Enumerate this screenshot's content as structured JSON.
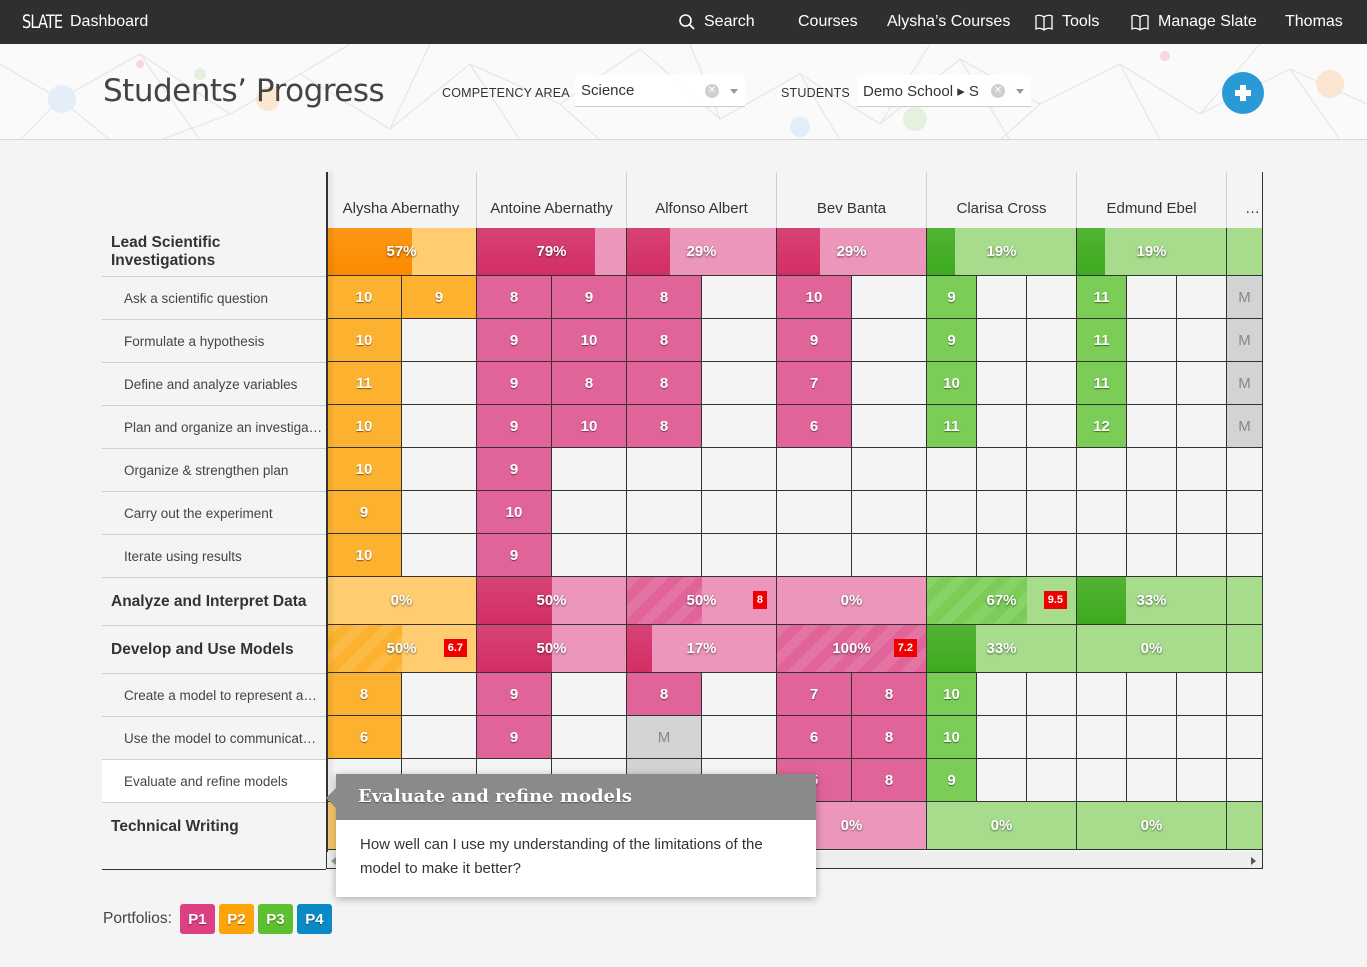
{
  "nav": {
    "logo": "SLATE",
    "brand": "Dashboard",
    "items": [
      {
        "label": "Search",
        "icon": "search-icon"
      },
      {
        "label": "Courses"
      },
      {
        "label": "Alysha’s Courses"
      },
      {
        "label": "Tools",
        "icon": "book-icon"
      },
      {
        "label": "Manage Slate",
        "icon": "book-icon"
      },
      {
        "label": "Thomas"
      }
    ]
  },
  "header": {
    "title": "Students’ Progress",
    "competency_label": "COMPETENCY AREA",
    "competency_value": "Science",
    "students_label": "STUDENTS",
    "students_value": "Demo School ▸ S",
    "add_button": "add-icon"
  },
  "colors": {
    "orange": "#fdb22f",
    "orange_dark": "#fb8a00",
    "orange_light": "#ffcc70",
    "pink": "#e0649a",
    "pink_dark": "#d22e65",
    "pink_light": "#ec96bb",
    "green": "#7bcd57",
    "green_dark": "#3daa1e",
    "green_light": "#a6dc8b",
    "missing": "#d3d3d3",
    "flag": "#ee0000"
  },
  "students": [
    {
      "name": "Alysha Abernathy",
      "color": "orange"
    },
    {
      "name": "Antoine Abernathy",
      "color": "pink"
    },
    {
      "name": "Alfonso Albert",
      "color": "pink"
    },
    {
      "name": "Bev Banta",
      "color": "pink"
    },
    {
      "name": "Clarisa Cross",
      "color": "green"
    },
    {
      "name": "Edmund Ebel",
      "color": "green"
    },
    {
      "name": "…",
      "color": "green"
    }
  ],
  "competencies": [
    {
      "name": "Lead Scientific Investigations",
      "progress": [
        {
          "pct": "57%",
          "fill": 0.57
        },
        {
          "pct": "79%",
          "fill": 0.79
        },
        {
          "pct": "29%",
          "fill": 0.29
        },
        {
          "pct": "29%",
          "fill": 0.29
        },
        {
          "pct": "19%",
          "fill": 0.19
        },
        {
          "pct": "19%",
          "fill": 0.19
        },
        {
          "pct": "",
          "fill": 0
        }
      ],
      "skills": [
        {
          "name": "Ask a scientific question",
          "scores": [
            [
              "10",
              "9"
            ],
            [
              "8",
              "9"
            ],
            [
              "8",
              ""
            ],
            [
              "10",
              ""
            ],
            [
              "9",
              "",
              ""
            ],
            [
              "11",
              "",
              ""
            ],
            [
              "M"
            ]
          ]
        },
        {
          "name": "Formulate a hypothesis",
          "scores": [
            [
              "10",
              ""
            ],
            [
              "9",
              "10"
            ],
            [
              "8",
              ""
            ],
            [
              "9",
              ""
            ],
            [
              "9",
              "",
              ""
            ],
            [
              "11",
              "",
              ""
            ],
            [
              "M"
            ]
          ]
        },
        {
          "name": "Define and analyze variables",
          "scores": [
            [
              "11",
              ""
            ],
            [
              "9",
              "8"
            ],
            [
              "8",
              ""
            ],
            [
              "7",
              ""
            ],
            [
              "10",
              "",
              ""
            ],
            [
              "11",
              "",
              ""
            ],
            [
              "M"
            ]
          ]
        },
        {
          "name": "Plan and organize an investiga…",
          "scores": [
            [
              "10",
              ""
            ],
            [
              "9",
              "10"
            ],
            [
              "8",
              ""
            ],
            [
              "6",
              ""
            ],
            [
              "11",
              "",
              ""
            ],
            [
              "12",
              "",
              ""
            ],
            [
              "M"
            ]
          ]
        },
        {
          "name": "Organize & strengthen plan",
          "scores": [
            [
              "10",
              ""
            ],
            [
              "9",
              ""
            ],
            [
              "",
              ""
            ],
            [
              "",
              ""
            ],
            [
              "",
              "",
              ""
            ],
            [
              "",
              "",
              ""
            ],
            [
              ""
            ]
          ]
        },
        {
          "name": "Carry out the experiment",
          "scores": [
            [
              "9",
              ""
            ],
            [
              "10",
              ""
            ],
            [
              "",
              ""
            ],
            [
              "",
              ""
            ],
            [
              "",
              "",
              ""
            ],
            [
              "",
              "",
              ""
            ],
            [
              ""
            ]
          ]
        },
        {
          "name": "Iterate using results",
          "scores": [
            [
              "10",
              ""
            ],
            [
              "9",
              ""
            ],
            [
              "",
              ""
            ],
            [
              "",
              ""
            ],
            [
              "",
              "",
              ""
            ],
            [
              "",
              "",
              ""
            ],
            [
              ""
            ]
          ]
        }
      ]
    },
    {
      "name": "Analyze and Interpret Data",
      "progress": [
        {
          "pct": "0%",
          "fill": 0
        },
        {
          "pct": "50%",
          "fill": 0.5
        },
        {
          "pct": "50%",
          "fill": 0.5,
          "flag": "8",
          "striped": true
        },
        {
          "pct": "0%",
          "fill": 0
        },
        {
          "pct": "67%",
          "fill": 0.67,
          "flag": "9.5",
          "striped": true
        },
        {
          "pct": "33%",
          "fill": 0.33
        },
        {
          "pct": "",
          "fill": 0
        }
      ],
      "skills": []
    },
    {
      "name": "Develop and Use Models",
      "progress": [
        {
          "pct": "50%",
          "fill": 0.5,
          "flag": "6.7",
          "striped": true
        },
        {
          "pct": "50%",
          "fill": 0.5
        },
        {
          "pct": "17%",
          "fill": 0.17
        },
        {
          "pct": "100%",
          "fill": 1.0,
          "flag": "7.2",
          "striped": true
        },
        {
          "pct": "33%",
          "fill": 0.33
        },
        {
          "pct": "0%",
          "fill": 0
        },
        {
          "pct": "",
          "fill": 0
        }
      ],
      "skills": [
        {
          "name": "Create a model to represent a…",
          "scores": [
            [
              "8",
              ""
            ],
            [
              "9",
              ""
            ],
            [
              "8",
              ""
            ],
            [
              "7",
              "8"
            ],
            [
              "10",
              "",
              ""
            ],
            [
              "",
              "",
              ""
            ],
            [
              ""
            ]
          ]
        },
        {
          "name": "Use the model to communicat…",
          "scores": [
            [
              "6",
              ""
            ],
            [
              "9",
              ""
            ],
            [
              "M",
              ""
            ],
            [
              "6",
              "8"
            ],
            [
              "10",
              "",
              ""
            ],
            [
              "",
              "",
              ""
            ],
            [
              ""
            ]
          ]
        },
        {
          "name": "Evaluate and refine models",
          "active": true,
          "scores": [
            [
              "",
              ""
            ],
            [
              "",
              ""
            ],
            [
              "M",
              ""
            ],
            [
              "5",
              "8"
            ],
            [
              "9",
              "",
              ""
            ],
            [
              "",
              "",
              ""
            ],
            [
              ""
            ]
          ]
        }
      ]
    },
    {
      "name": "Technical Writing",
      "progress": [
        {
          "pct": "",
          "fill": 0
        },
        {
          "pct": "",
          "fill": 0
        },
        {
          "pct": "",
          "fill": 0
        },
        {
          "pct": "0%",
          "fill": 0
        },
        {
          "pct": "0%",
          "fill": 0
        },
        {
          "pct": "0%",
          "fill": 0
        },
        {
          "pct": "",
          "fill": 0
        }
      ],
      "skills": []
    }
  ],
  "tooltip": {
    "title": "Evaluate and refine models",
    "body": "How well can I use my understanding of the limitations of the model to make it better?"
  },
  "portfolios": {
    "label": "Portfolios:",
    "items": [
      {
        "label": "P1",
        "color": "#dc3f82"
      },
      {
        "label": "P2",
        "color": "#fda40a"
      },
      {
        "label": "P3",
        "color": "#5cc02f"
      },
      {
        "label": "P4",
        "color": "#0a8ac4"
      }
    ]
  }
}
